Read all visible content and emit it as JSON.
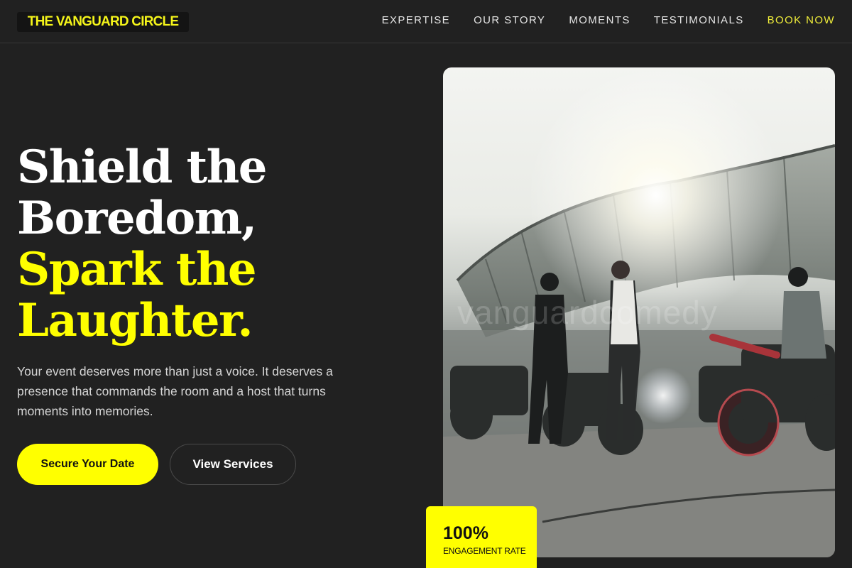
{
  "brand": {
    "logo_text": "THE VANGUARD CIRCLE"
  },
  "nav": {
    "links": [
      "EXPERTISE",
      "OUR STORY",
      "MOMENTS",
      "TESTIMONIALS"
    ],
    "cta": "BOOK NOW"
  },
  "hero": {
    "headline_lines": [
      "Shield the",
      "Boredom,",
      "Spark the",
      "Laughter."
    ],
    "subtext": "Your event deserves more than just a voice. It deserves a presence that commands the room and a host that turns moments into memories.",
    "primary_button": "Secure Your Date",
    "secondary_button": "View Services"
  },
  "image": {
    "watermark": "vanguardcomedy"
  },
  "stat": {
    "value": "100%",
    "label": "ENGAGEMENT RATE"
  },
  "colors": {
    "background": "#212121",
    "accent": "#ffff00"
  }
}
